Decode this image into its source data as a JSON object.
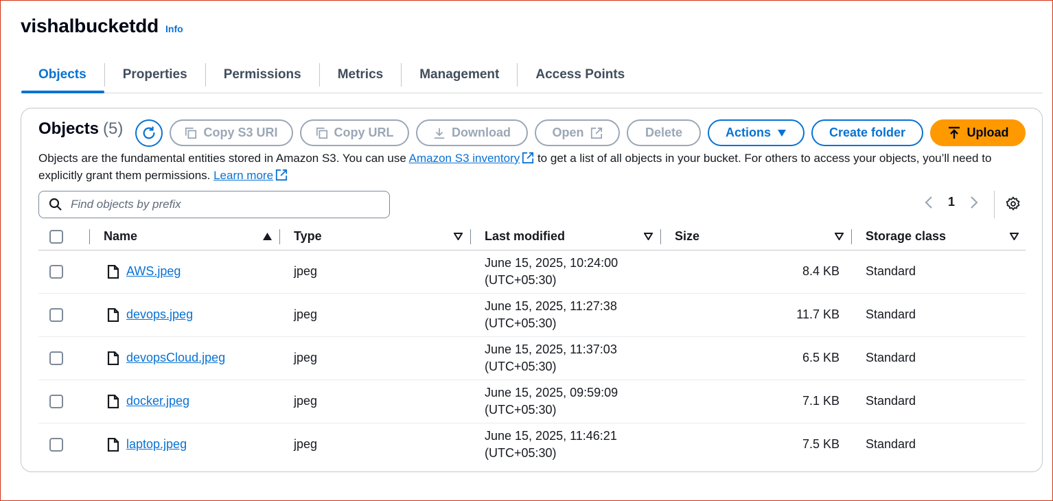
{
  "bucket": {
    "name": "vishalbucketdd",
    "info_label": "Info"
  },
  "tabs": [
    {
      "label": "Objects",
      "active": true
    },
    {
      "label": "Properties"
    },
    {
      "label": "Permissions"
    },
    {
      "label": "Metrics"
    },
    {
      "label": "Management"
    },
    {
      "label": "Access Points"
    }
  ],
  "objects_panel": {
    "title": "Objects",
    "count": "(5)",
    "buttons": {
      "copy_s3_uri": "Copy S3 URI",
      "copy_url": "Copy URL",
      "download": "Download",
      "open": "Open",
      "delete": "Delete",
      "actions": "Actions",
      "create_folder": "Create folder",
      "upload": "Upload"
    },
    "description": {
      "part1": "Objects are the fundamental entities stored in Amazon S3. You can use ",
      "link1": "Amazon S3 inventory",
      "part2": " to get a list of all objects in your bucket. For others to access your objects, you’ll need to explicitly grant them permissions. ",
      "link2": "Learn more"
    },
    "search": {
      "placeholder": "Find objects by prefix",
      "value": ""
    },
    "pagination": {
      "current_page": "1"
    }
  },
  "table": {
    "columns": {
      "name": "Name",
      "type": "Type",
      "last_modified": "Last modified",
      "size": "Size",
      "storage_class": "Storage class"
    },
    "rows": [
      {
        "name": "AWS.jpeg",
        "type": "jpeg",
        "date": "June 15, 2025, 10:24:00",
        "tz": "(UTC+05:30)",
        "size": "8.4 KB",
        "storage": "Standard"
      },
      {
        "name": "devops.jpeg",
        "type": "jpeg",
        "date": "June 15, 2025, 11:27:38",
        "tz": "(UTC+05:30)",
        "size": "11.7 KB",
        "storage": "Standard"
      },
      {
        "name": "devopsCloud.jpeg",
        "type": "jpeg",
        "date": "June 15, 2025, 11:37:03",
        "tz": "(UTC+05:30)",
        "size": "6.5 KB",
        "storage": "Standard"
      },
      {
        "name": "docker.jpeg",
        "type": "jpeg",
        "date": "June 15, 2025, 09:59:09",
        "tz": "(UTC+05:30)",
        "size": "7.1 KB",
        "storage": "Standard"
      },
      {
        "name": "laptop.jpeg",
        "type": "jpeg",
        "date": "June 15, 2025, 11:46:21",
        "tz": "(UTC+05:30)",
        "size": "7.5 KB",
        "storage": "Standard"
      }
    ]
  },
  "colors": {
    "accent": "#0972d3",
    "upload": "#ff9900",
    "disabled": "#9ba7b6"
  },
  "icons": [
    "refresh-icon",
    "copy-icon",
    "download-icon",
    "external-link-icon",
    "caret-down-icon",
    "upload-icon",
    "search-icon",
    "chevron-left-icon",
    "chevron-right-icon",
    "gear-icon",
    "file-icon",
    "sort-ascending-icon",
    "sort-icon"
  ]
}
